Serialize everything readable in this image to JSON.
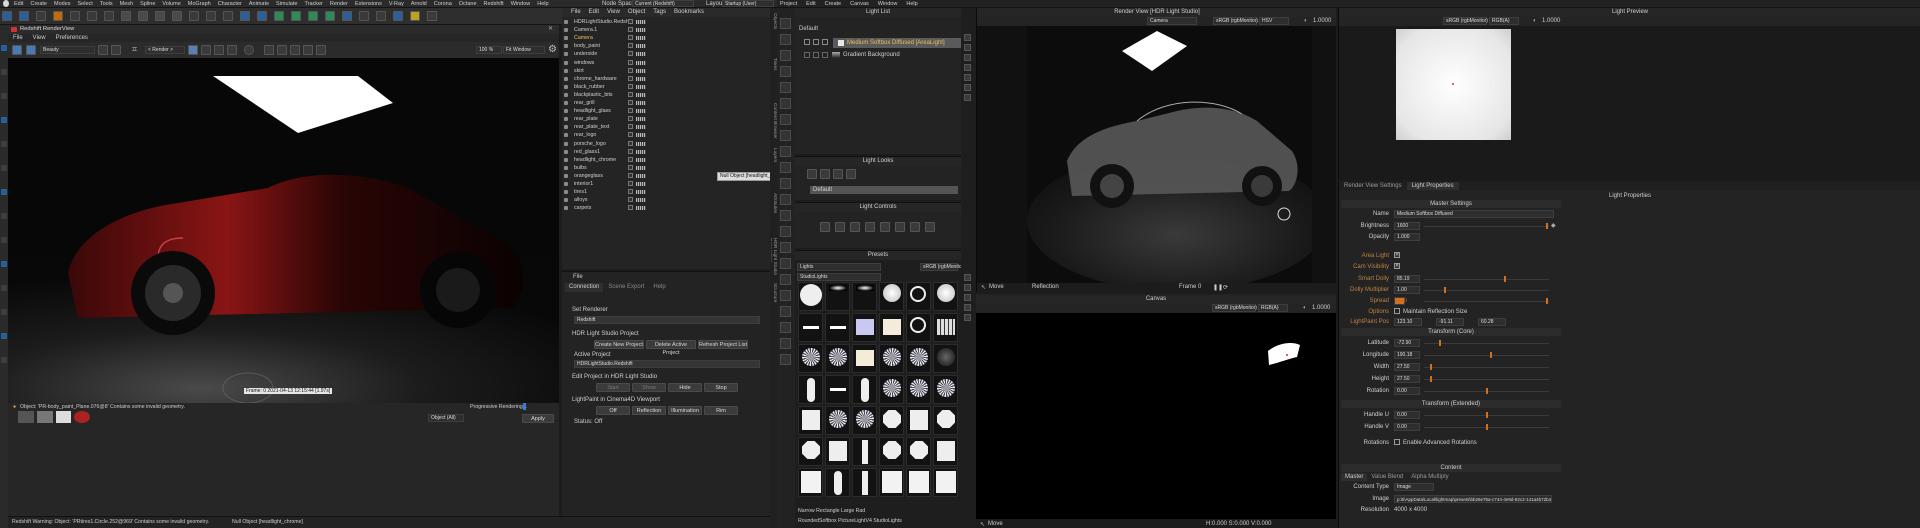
{
  "c4d_menu": [
    "Edit",
    "Create",
    "Modes",
    "Select",
    "Tools",
    "Mesh",
    "Spline",
    "Volume",
    "MoGraph",
    "Character",
    "Animate",
    "Simulate",
    "Tracker",
    "Render",
    "Extensions",
    "V-Ray",
    "Arnold",
    "Corona",
    "Octane",
    "Redshift",
    "Window",
    "Help"
  ],
  "node_space": {
    "label": "Node Space:",
    "value": "Current (Redshift)"
  },
  "layout": {
    "label": "Layout:",
    "value": "Startup (User)"
  },
  "redshift": {
    "title": "Redshift RenderView",
    "menu": [
      "File",
      "View",
      "Preferences"
    ],
    "aov": "Beauty",
    "render_cam": "< Render >",
    "zoom": "100 %",
    "fit": "Fit Window",
    "frame": "Frame: 0  2021-04-13 12:15:44 [1.97s]",
    "status": "Object: 'PR-body_paint_Plane.076@8' Contains some invalid geometry.",
    "progressive": "Progressive Rendering...",
    "object_label": "Object (All)",
    "apply": "Apply",
    "log": "Redshift Warning: Object: 'PRtires1.Circle.252@969' Contains some invalid geometry.",
    "null_status": "Null Object [headlight_chrome]"
  },
  "om": {
    "menu": [
      "File",
      "Edit",
      "View",
      "Object",
      "Tags",
      "Bookmarks"
    ],
    "items": [
      "HDRLightStudio.Redshift",
      "Camera.1",
      "Camera",
      "body_paint",
      "underside",
      "windows",
      "skirt",
      "chrome_hardware",
      "black_rubber",
      "blackplastic_bits",
      "rear_grill",
      "headlight_glass",
      "rear_plate",
      "rear_plate_text",
      "rear_logo",
      "porsche_logo",
      "red_glass1",
      "headlight_chrome",
      "bulbs",
      "orangeglass",
      "interior1",
      "tires1",
      "alloys",
      "carpets"
    ],
    "tooltip": "Null Object [headlight_chrome]",
    "side_tabs": [
      "Objects",
      "Takes",
      "Content Browser",
      "Layers",
      "Attributes",
      "HDR Light Studio Connection",
      "Structure"
    ]
  },
  "conn": {
    "file": "File",
    "tabs": [
      "Connection",
      "Scene Export",
      "Help"
    ],
    "set_renderer": "Set Renderer",
    "renderer": "Redshift",
    "project_section": "HDR Light Studio Project",
    "create": "Create New Project",
    "delete": "Delete Active Project",
    "refresh": "Refresh Project List",
    "active_label": "Active Project",
    "active_value": "HDRLightStudio.Redshift",
    "edit_section": "Edit Project in HDR Light Studio",
    "start": "Start",
    "show": "Show",
    "hide": "Hide",
    "stop": "Stop",
    "lp_section": "LightPaint in Cinema4D Viewport",
    "off": "Off",
    "reflection": "Reflection",
    "illumination": "Illumination",
    "rim": "Rim",
    "status": "Status: Off"
  },
  "hls_menu": [
    "Project",
    "Edit",
    "Create",
    "Canvas",
    "Window",
    "Help"
  ],
  "light_list": {
    "title": "Light List",
    "group": "Default",
    "lights": [
      "Medium Softbox Diffused [AreaLight]",
      "Gradient Background"
    ]
  },
  "light_looks": {
    "title": "Light Looks",
    "item": "Default"
  },
  "light_controls": {
    "title": "Light Controls"
  },
  "presets": {
    "title": "Presets",
    "category": "Lights",
    "sub": "StudioLights",
    "color": "sRGB (rgbMonitor)",
    "name1": "Narrow Rectangle Large Rad",
    "name2": "RoundedSoftbox PictureLightV4 StudioLights"
  },
  "render_view": {
    "title": "Render View [HDR Light Studio]",
    "camera": "Camera",
    "colorspace": "sRGB (rgbMonitor)",
    "mode": "HSV",
    "exposure": "1.0000",
    "move": "Move",
    "reflection": "Reflection",
    "frame": "Frame 0"
  },
  "canvas": {
    "title": "Canvas",
    "colorspace": "sRGB (rgbMonitor)",
    "channel": "RGB(A)",
    "exposure": "1.0000",
    "move": "Move",
    "coords": "H:0.000 S:0.000 V:0.000"
  },
  "light_preview": {
    "title": "Light Preview",
    "colorspace": "sRGB (rgbMonitor)",
    "channel": "RGB(A)",
    "exposure": "1.0000"
  },
  "props": {
    "tabs": [
      "Render View Settings",
      "Light Properties"
    ],
    "title": "Light Properties",
    "master": "Master Settings",
    "name_label": "Name",
    "name": "Medium Softbox Diffused",
    "brightness_label": "Brightness",
    "brightness": "1600",
    "opacity_label": "Opacity",
    "opacity": "1.000",
    "area_label": "Area Light",
    "cam_label": "Cam Visibility",
    "smart_label": "Smart Dolly",
    "smart": "85.19",
    "dolly_label": "Dolly Multiplier",
    "dolly": "1.00",
    "spread_label": "Spread",
    "spread": "1.00",
    "options_label": "Options",
    "maintain": "Maintain Reflection Size",
    "lp_label": "LightPaint Pos",
    "lp1": "123.10",
    "lp2": "-91.11",
    "lp3": "60.28",
    "transform": "Transform (Core)",
    "lat_label": "Latitude",
    "lat": "-72.90",
    "lon_label": "Longitude",
    "lon": "190.18",
    "width_label": "Width",
    "width": "27.50",
    "height_label": "Height",
    "height": "27.50",
    "rot_label": "Rotation",
    "rot": "0.00",
    "extended": "Transform (Extended)",
    "hu_label": "Handle U",
    "hu": "0.00",
    "hv_label": "Handle V",
    "hv": "0.00",
    "rotations": "Rotations",
    "adv": "Enable Advanced Rotations",
    "content": "Content",
    "ctabs": [
      "Master",
      "Value Blend",
      "Alpha Multiply"
    ],
    "ctype_label": "Content Type",
    "ctype": "Image",
    "image_label": "Image",
    "image": "p:\\ti\\AppData\\Local\\lightmap\\presets\\bb26e75a-c744-4e9d-82c2-141a4b72b4a.tx",
    "res_label": "Resolution",
    "res": "4000 x 4000"
  },
  "colors": {
    "accent": "#d07020",
    "selected_text": "#e8c060"
  }
}
